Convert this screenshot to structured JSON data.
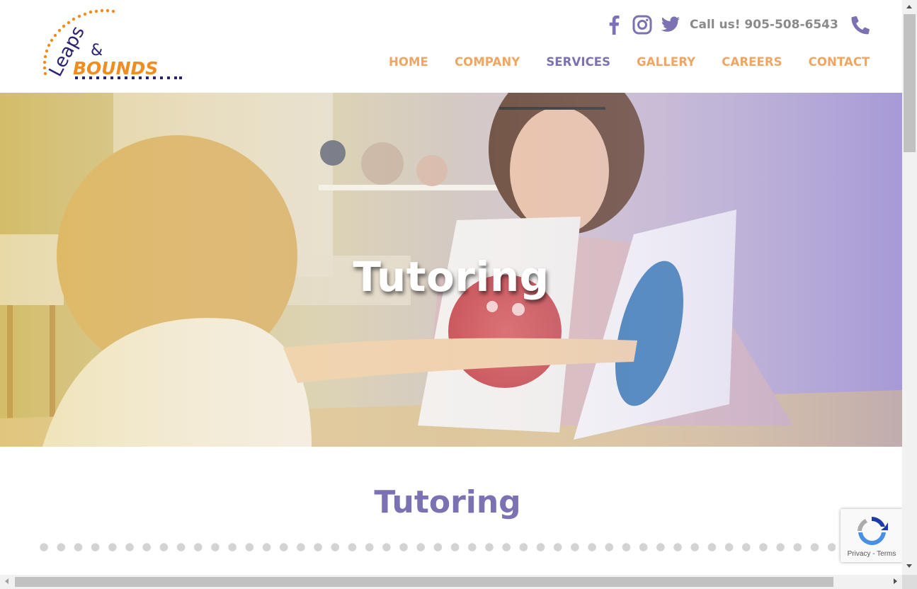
{
  "brand": {
    "logo_top": "Leaps",
    "logo_amp": "&",
    "logo_bottom": "BOUNDS",
    "colors": {
      "orange": "#f28c1f",
      "navy": "#2a2272",
      "purple": "#7b72b3",
      "nav_orange": "#f0a662"
    }
  },
  "topbar": {
    "social_icons": [
      "facebook-icon",
      "instagram-icon",
      "twitter-icon"
    ],
    "call_text": "Call us! 905-508-6543",
    "phone_icon": "phone-icon"
  },
  "nav": {
    "items": [
      {
        "label": "HOME",
        "active": false
      },
      {
        "label": "COMPANY",
        "active": false
      },
      {
        "label": "SERVICES",
        "active": true
      },
      {
        "label": "GALLERY",
        "active": false
      },
      {
        "label": "CAREERS",
        "active": false
      },
      {
        "label": "CONTACT",
        "active": false
      }
    ]
  },
  "hero": {
    "title": "Tutoring"
  },
  "main": {
    "title": "Tutoring"
  },
  "recaptcha": {
    "links": "Privacy - Terms"
  }
}
